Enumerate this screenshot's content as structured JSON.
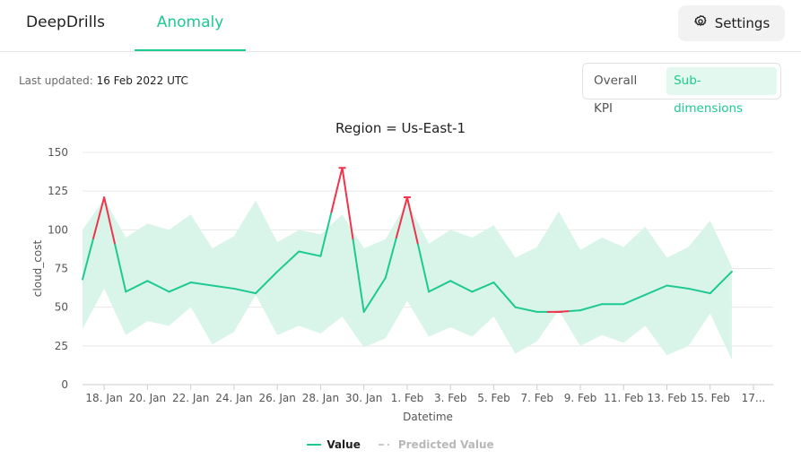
{
  "nav": {
    "tabs": [
      {
        "label": "DeepDrills",
        "active": false
      },
      {
        "label": "Anomaly",
        "active": true
      }
    ],
    "settings_label": "Settings",
    "settings_icon": "gear-icon",
    "accent_color": "#1ec992"
  },
  "header": {
    "last_updated_label": "Last updated:",
    "last_updated_value": "16 Feb 2022 UTC",
    "toggle": {
      "overall_label": "Overall KPI",
      "sub_label": "Sub-dimensions",
      "selected": "Sub-dimensions"
    }
  },
  "chart_data": {
    "type": "line",
    "title": "Region = Us-East-1",
    "xlabel": "Datetime",
    "ylabel": "cloud_cost",
    "ylim": [
      0,
      150
    ],
    "yticks": [
      0,
      25,
      50,
      75,
      100,
      125,
      150
    ],
    "xlim": [
      "17 Jan",
      "17 Feb"
    ],
    "xticks": [
      "18. Jan",
      "20. Jan",
      "22. Jan",
      "24. Jan",
      "26. Jan",
      "28. Jan",
      "30. Jan",
      "1. Feb",
      "3. Feb",
      "5. Feb",
      "7. Feb",
      "9. Feb",
      "11. Feb",
      "13. Feb",
      "15. Feb",
      "17..."
    ],
    "grid": true,
    "legend": [
      {
        "name": "Value",
        "color": "#1ec992"
      },
      {
        "name": "Predicted Value",
        "color": "#cccccc"
      }
    ],
    "anomaly_color": "#f0334b",
    "band_color": "#d9f5ea",
    "x": [
      "17 Jan",
      "18 Jan",
      "19 Jan",
      "20 Jan",
      "21 Jan",
      "22 Jan",
      "23 Jan",
      "24 Jan",
      "25 Jan",
      "26 Jan",
      "27 Jan",
      "28 Jan",
      "29 Jan",
      "30 Jan",
      "31 Jan",
      "1 Feb",
      "2 Feb",
      "3 Feb",
      "4 Feb",
      "5 Feb",
      "6 Feb",
      "7 Feb",
      "8 Feb",
      "9 Feb",
      "10 Feb",
      "11 Feb",
      "12 Feb",
      "13 Feb",
      "14 Feb",
      "15 Feb",
      "16 Feb",
      "17 Feb"
    ],
    "series": [
      {
        "name": "Value",
        "values": [
          68,
          121,
          60,
          67,
          60,
          66,
          64,
          62,
          59,
          73,
          86,
          83,
          140,
          47,
          69,
          121,
          60,
          67,
          60,
          66,
          50,
          47,
          47,
          48,
          52,
          52,
          58,
          64,
          62,
          59,
          73
        ]
      }
    ],
    "band": {
      "upper": [
        100,
        120,
        95,
        104,
        100,
        110,
        88,
        96,
        119,
        92,
        100,
        97,
        110,
        88,
        94,
        118,
        91,
        100,
        95,
        103,
        82,
        89,
        112,
        87,
        95,
        89,
        102,
        82,
        89,
        106,
        76
      ],
      "lower": [
        36,
        62,
        32,
        41,
        38,
        50,
        26,
        34,
        58,
        32,
        38,
        33,
        44,
        24,
        30,
        54,
        31,
        37,
        31,
        44,
        20,
        28,
        48,
        25,
        32,
        27,
        38,
        19,
        25,
        46,
        16
      ]
    },
    "anomalies": [
      {
        "x": "29 Jan",
        "value": 140
      },
      {
        "x": "1 Feb",
        "value": 121
      },
      {
        "x": "8 Feb",
        "value": 47
      }
    ]
  }
}
